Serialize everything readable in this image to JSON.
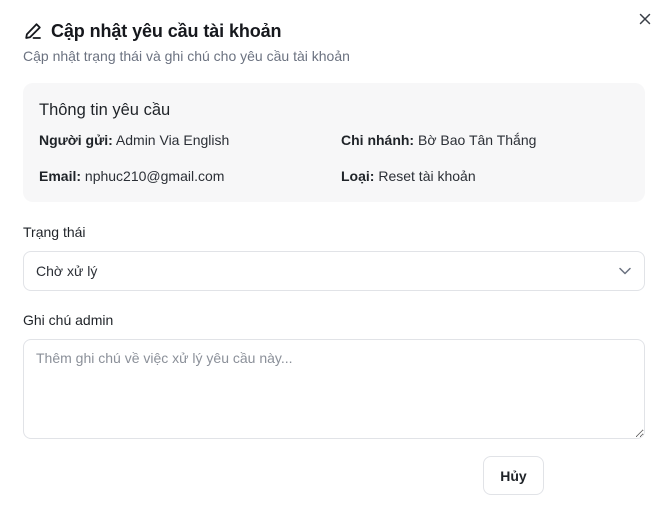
{
  "dialog": {
    "title": "Cập nhật yêu cầu tài khoản",
    "subtitle": "Cập nhật trạng thái và ghi chú cho yêu cầu tài khoản",
    "title_icon": "pencil-icon",
    "close_icon": "close-icon"
  },
  "info": {
    "heading": "Thông tin yêu cầu",
    "sender_label": "Người gửi:",
    "sender_value": "Admin Via English",
    "branch_label": "Chi nhánh:",
    "branch_value": "Bờ Bao Tân Thắng",
    "email_label": "Email:",
    "email_value": "nphuc210@gmail.com",
    "type_label": "Loại:",
    "type_value": "Reset tài khoản"
  },
  "status": {
    "label": "Trạng thái",
    "selected": "Chờ xử lý",
    "icon": "chevron-down-icon"
  },
  "note": {
    "label": "Ghi chú admin",
    "placeholder": "Thêm ghi chú về việc xử lý yêu cầu này...",
    "value": ""
  },
  "actions": {
    "cancel_label": "Hủy"
  },
  "colors": {
    "card_bg": "#f7f7f8",
    "border": "#e1e3e7",
    "muted_text": "#6b7280"
  }
}
